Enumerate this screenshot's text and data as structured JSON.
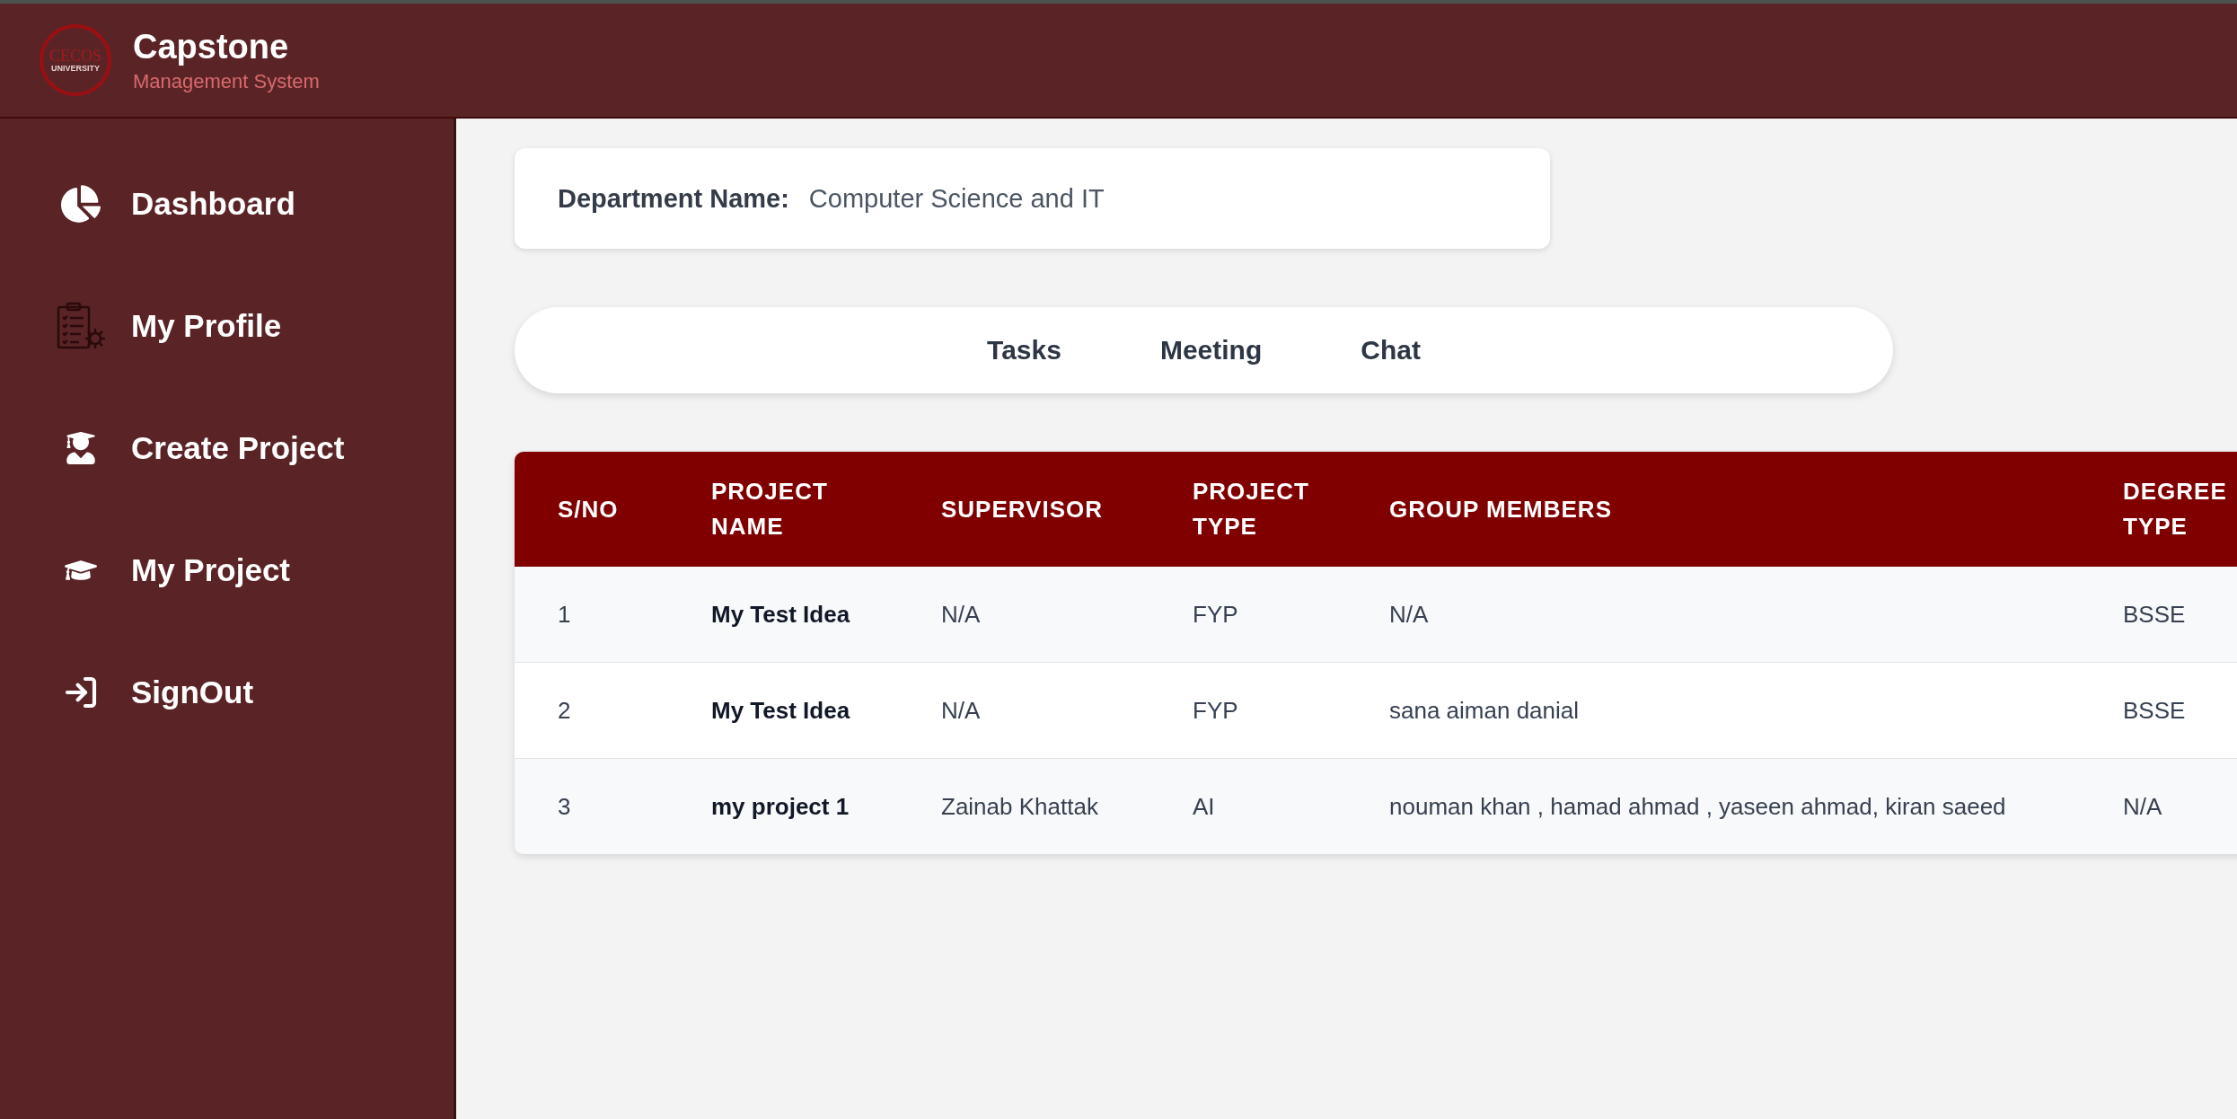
{
  "header": {
    "logo": {
      "name": "CECOS",
      "subtitle": "UNIVERSITY"
    },
    "title": "Capstone",
    "subtitle": "Management System"
  },
  "sidebar": {
    "items": [
      {
        "label": "Dashboard"
      },
      {
        "label": "My Profile"
      },
      {
        "label": "Create Project"
      },
      {
        "label": "My Project"
      },
      {
        "label": "SignOut"
      }
    ]
  },
  "department": {
    "label": "Department Name:",
    "value": "Computer Science and IT"
  },
  "tabs": [
    {
      "label": "Tasks"
    },
    {
      "label": "Meeting"
    },
    {
      "label": "Chat"
    }
  ],
  "table": {
    "columns": [
      "S/NO",
      "PROJECT\nNAME",
      "SUPERVISOR",
      "PROJECT\nTYPE",
      "GROUP MEMBERS",
      "DEGREE\nTYPE"
    ],
    "rows": [
      [
        "1",
        "My Test Idea",
        "N/A",
        "FYP",
        "N/A",
        "BSSE"
      ],
      [
        "2",
        "My Test Idea",
        "N/A",
        "FYP",
        "sana aiman danial",
        "BSSE"
      ],
      [
        "3",
        "my project 1",
        "Zainab Khattak",
        "AI",
        "nouman khan , hamad ahmad , yaseen ahmad, kiran saeed",
        "N/A"
      ]
    ]
  }
}
